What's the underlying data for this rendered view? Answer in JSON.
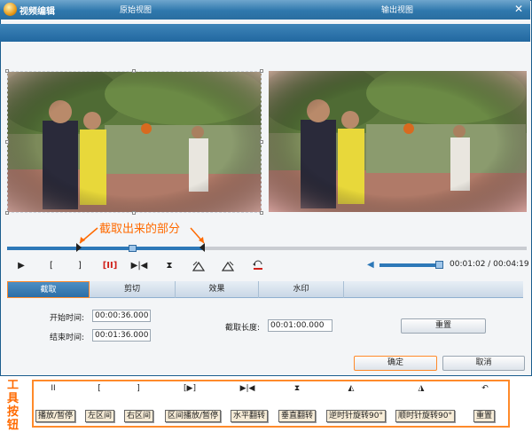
{
  "window": {
    "title": "视频编辑",
    "close_symbol": "✕"
  },
  "views": {
    "original_label": "原始视图",
    "output_label": "输出视图"
  },
  "annotation": "截取出来的部分",
  "toolbar": {
    "play": "▶",
    "left_bracket": "[",
    "right_bracket": "]",
    "region_play": "[II]",
    "flip_h": "▶|◀",
    "flip_v": "⧗",
    "time_readout": "00:01:02 / 00:04:19"
  },
  "tabs": [
    "截取",
    "剪切",
    "效果",
    "水印"
  ],
  "form": {
    "start_label": "开始时间:",
    "start_value": "00:00:36.000",
    "end_label": "结束时间:",
    "end_value": "00:01:36.000",
    "length_label": "截取长度:",
    "length_value": "00:01:00.000",
    "reset_label": "重置"
  },
  "dialog": {
    "ok": "确定",
    "cancel": "取消"
  },
  "legend": {
    "side_chars": [
      "工",
      "具",
      "按",
      "钮"
    ],
    "items": [
      {
        "icon": "II",
        "label": "播放/暂停"
      },
      {
        "icon": "[",
        "label": "左区间"
      },
      {
        "icon": "]",
        "label": "右区间"
      },
      {
        "icon": "[▶]",
        "label": "区间播放/暂停"
      },
      {
        "icon": "▶|◀",
        "label": "水平翻转"
      },
      {
        "icon": "⧗",
        "label": "垂直翻转"
      },
      {
        "icon": "◭",
        "label": "逆时针旋转90°"
      },
      {
        "icon": "◮",
        "label": "顺时针旋转90°"
      },
      {
        "icon": "↶",
        "label": "重置"
      }
    ]
  },
  "colors": {
    "accent": "#2d78b8",
    "highlight": "#ff8a2a",
    "annotation": "#ff6a00"
  }
}
